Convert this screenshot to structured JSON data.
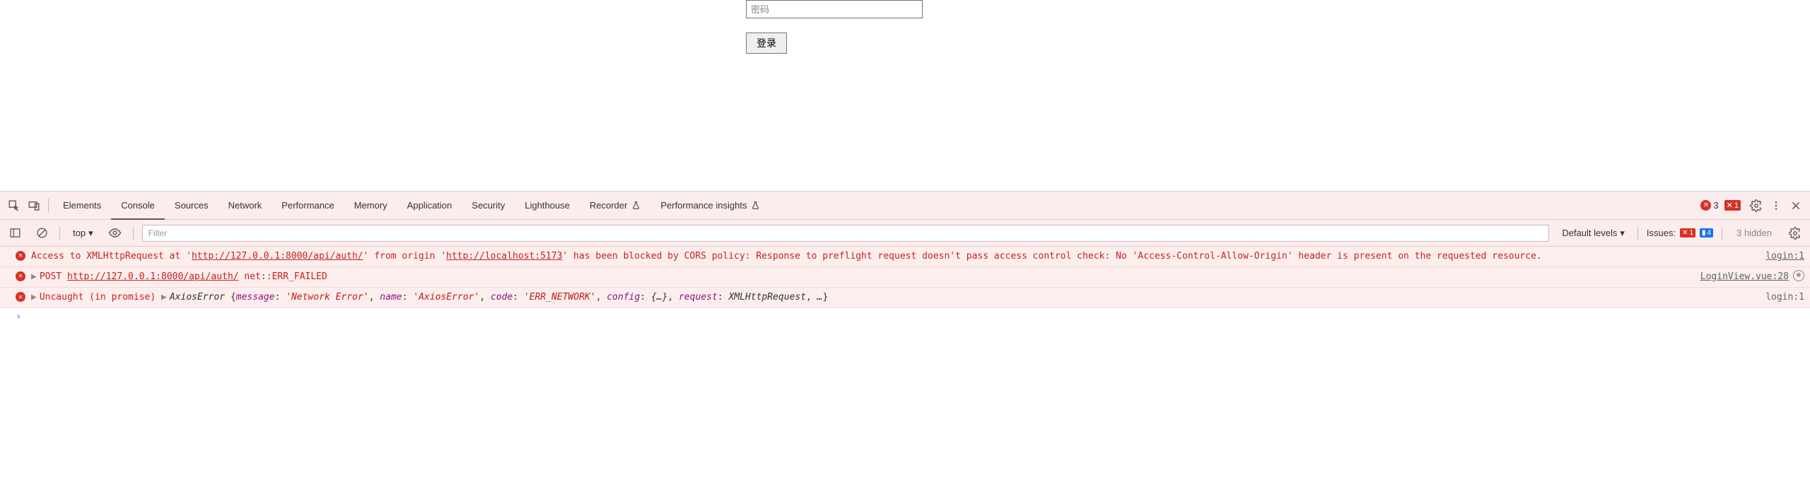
{
  "page": {
    "password_placeholder": "密码",
    "login_button": "登录"
  },
  "devtools": {
    "tabs": {
      "elements": "Elements",
      "console": "Console",
      "sources": "Sources",
      "network": "Network",
      "performance": "Performance",
      "memory": "Memory",
      "application": "Application",
      "security": "Security",
      "lighthouse": "Lighthouse",
      "recorder": "Recorder",
      "perf_insights": "Performance insights"
    },
    "error_count": "3",
    "error_square_count": "1"
  },
  "console_toolbar": {
    "context": "top",
    "filter_placeholder": "Filter",
    "levels": "Default levels",
    "issues_label": "Issues:",
    "issues_error": "1",
    "issues_info": "4",
    "hidden": "3 hidden"
  },
  "messages": {
    "m1": {
      "pre": "Access to XMLHttpRequest at '",
      "url1": "http://127.0.0.1:8000/api/auth/",
      "mid": "' from origin '",
      "url2": "http://localhost:5173",
      "post": "' has been blocked by CORS policy: Response to preflight request doesn't pass access control check: No 'Access-Control-Allow-Origin' header is present on the requested resource.",
      "source": "login:1"
    },
    "m2": {
      "method": "POST",
      "url": "http://127.0.0.1:8000/api/auth/",
      "tail": " net::ERR_FAILED",
      "source": "LoginView.vue:28"
    },
    "m3": {
      "pre": "Uncaught (in promise)  ",
      "cls": "AxiosError",
      "k_message": "message",
      "v_message": "'Network Error'",
      "k_name": "name",
      "v_name": "'AxiosError'",
      "k_code": "code",
      "v_code": "'ERR_NETWORK'",
      "k_config": "config",
      "v_config": "{…}",
      "k_request": "request",
      "v_request": "XMLHttpRequest",
      "ellipsis": "…",
      "source": "login:1"
    }
  }
}
